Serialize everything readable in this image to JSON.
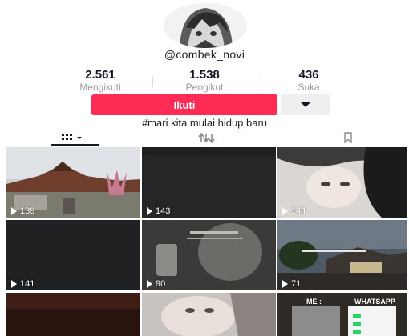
{
  "profile": {
    "username": "@combek_novi",
    "bio": "#mari kita mulai hidup baru",
    "stats": [
      {
        "value": "2.561",
        "label": "Mengikuti"
      },
      {
        "value": "1.538",
        "label": "Pengikut"
      },
      {
        "value": "436",
        "label": "Suka"
      }
    ]
  },
  "actions": {
    "follow_label": "Ikuti",
    "more_icon": "caret-down-icon"
  },
  "tabs": [
    {
      "icon": "videos-grid-icon",
      "selected": true
    },
    {
      "icon": "reposts-icon",
      "selected": false
    },
    {
      "icon": "bookmark-icon",
      "selected": false
    }
  ],
  "videos": [
    {
      "views": "139"
    },
    {
      "views": "143"
    },
    {
      "views": "144"
    },
    {
      "views": "141"
    },
    {
      "views": "90"
    },
    {
      "views": "71"
    },
    {
      "views": ""
    },
    {
      "views": ""
    },
    {
      "views": ""
    }
  ],
  "overlays": {
    "v9_left": "ME :",
    "v9_right": "WHATSAPP"
  },
  "colors": {
    "accent": "#fe2c55",
    "text": "#161823",
    "muted": "#9a9a9a"
  }
}
